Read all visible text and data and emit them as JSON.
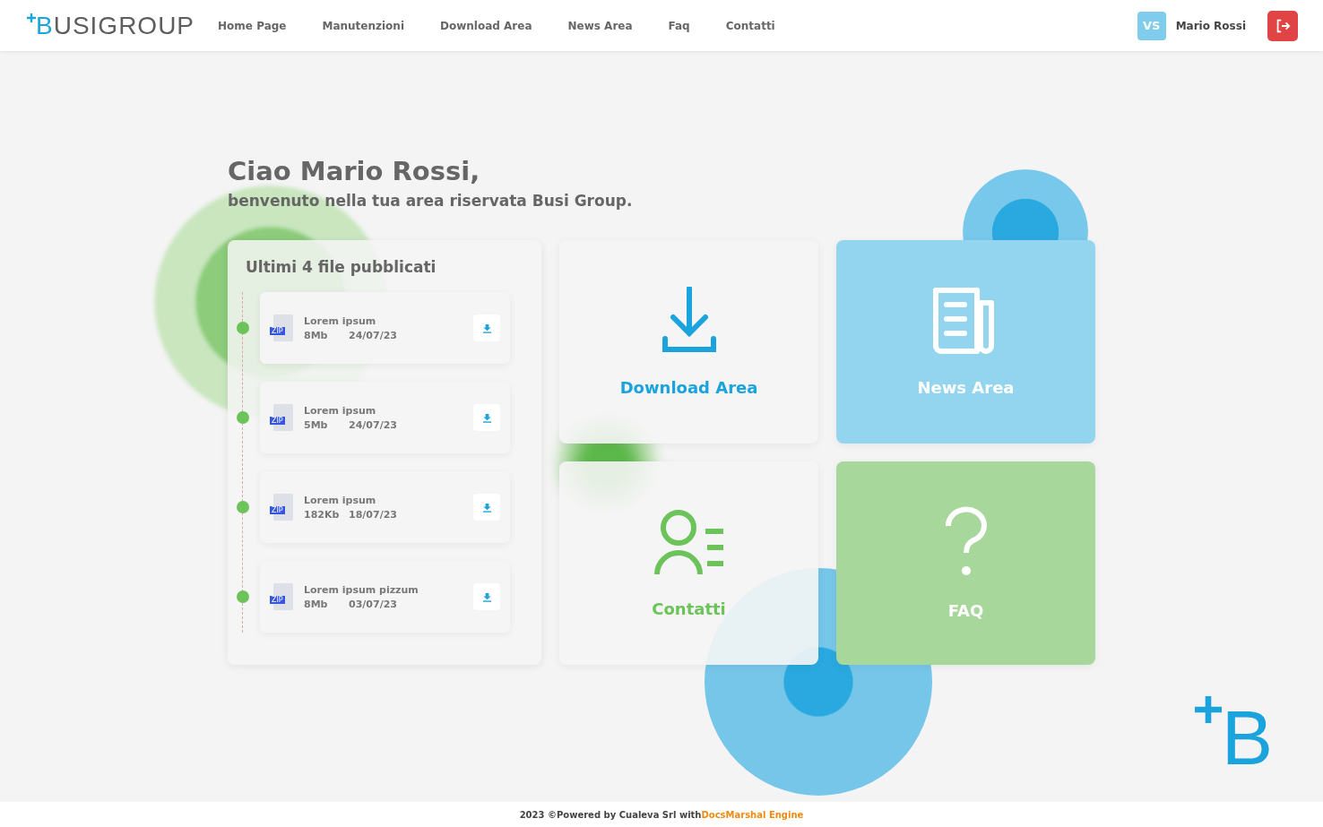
{
  "header": {
    "logo": "BUSIGROUP",
    "nav": [
      {
        "label": "Home Page"
      },
      {
        "label": "Manutenzioni"
      },
      {
        "label": "Download Area"
      },
      {
        "label": "News Area"
      },
      {
        "label": "Faq"
      },
      {
        "label": "Contatti"
      }
    ],
    "user": {
      "initials": "VS",
      "name": "Mario Rossi"
    }
  },
  "greeting": {
    "title": "Ciao Mario Rossi,",
    "subtitle": "benvenuto nella tua area riservata Busi Group."
  },
  "files": {
    "title": "Ultimi 4 file pubblicati",
    "items": [
      {
        "badge": "ZIP",
        "name": "Lorem ipsum",
        "size": "8Mb",
        "date": "24/07/23"
      },
      {
        "badge": "ZIP",
        "name": "Lorem ipsum",
        "size": "5Mb",
        "date": "24/07/23"
      },
      {
        "badge": "ZIP",
        "name": "Lorem ipsum",
        "size": "182Kb",
        "date": "18/07/23"
      },
      {
        "badge": "ZIP",
        "name": "Lorem ipsum pizzum",
        "size": "8Mb",
        "date": "03/07/23"
      }
    ]
  },
  "tiles": [
    {
      "kind": "download",
      "label": "Download Area"
    },
    {
      "kind": "news",
      "label": "News Area"
    },
    {
      "kind": "contacts",
      "label": "Contatti"
    },
    {
      "kind": "faq",
      "label": "FAQ"
    }
  ],
  "corner_logo": "B",
  "footer": {
    "text": "2023 ©Powered by Cualeva Srl with",
    "link": "DocsMarshal Engine"
  }
}
